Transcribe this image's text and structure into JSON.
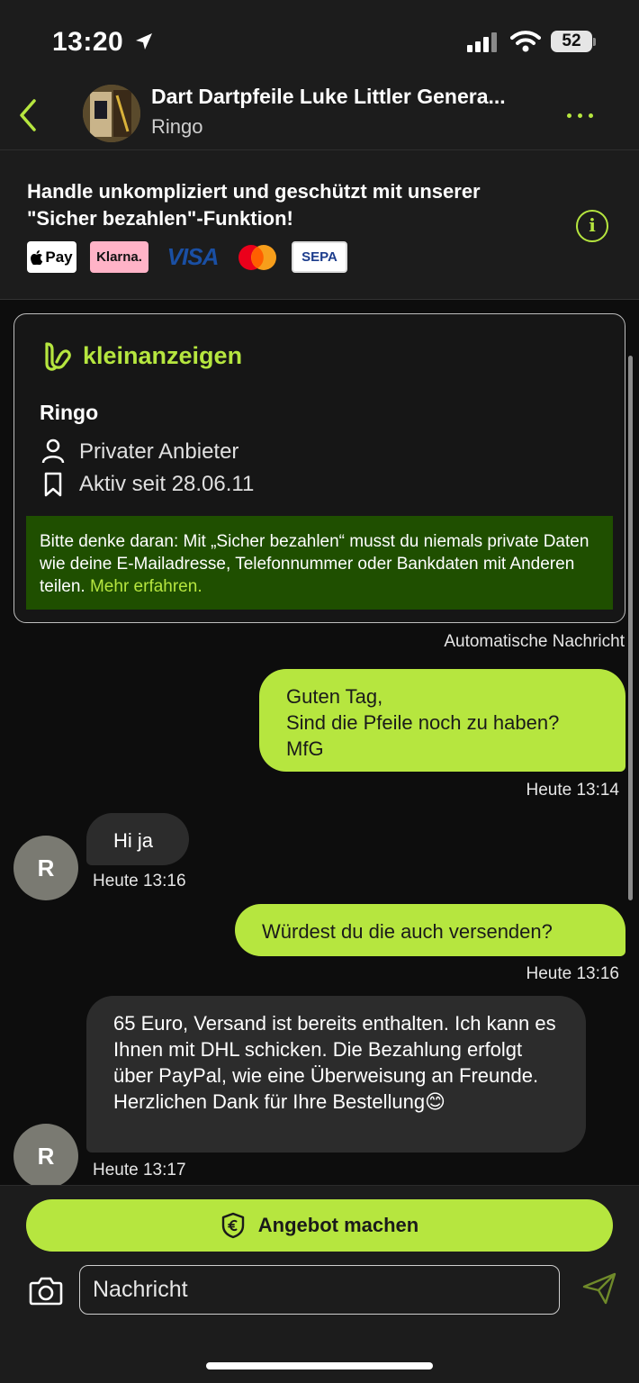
{
  "status": {
    "time": "13:20",
    "battery": "52"
  },
  "header": {
    "title": "Dart Dartpfeile Luke Littler Genera...",
    "subtitle": "Ringo"
  },
  "banner": {
    "text": "Handle unkompliziert und geschützt mit unserer \"Sicher bezahlen\"-Funktion!",
    "logos": [
      "Pay",
      "Klarna.",
      "VISA",
      "SEPA"
    ]
  },
  "card": {
    "brand": "kleinanzeigen",
    "name": "Ringo",
    "seller_type": "Privater Anbieter",
    "active_since": "Aktiv seit 28.06.11",
    "notice": "Bitte denke daran: Mit „Sicher bezahlen“ musst du niemals private Daten wie deine E-Mailadresse, Telefonnummer oder Bankdaten mit Anderen teilen.",
    "notice_link": "Mehr erfahren."
  },
  "auto_message_label": "Automatische Nachricht",
  "messages": [
    {
      "direction": "out",
      "lines": [
        "Guten Tag,",
        "Sind die Pfeile noch zu haben?",
        "MfG"
      ],
      "time": "Heute 13:14"
    },
    {
      "direction": "in",
      "text": "Hi ja",
      "time": "Heute 13:16",
      "avatar": "R"
    },
    {
      "direction": "out",
      "text": "Würdest du die auch versenden?",
      "time": "Heute 13:16"
    },
    {
      "direction": "in",
      "text": "65 Euro, Versand ist bereits enthalten. Ich kann es Ihnen mit DHL schicken. Die Bezahlung erfolgt über PayPal, wie eine Überweisung an Freunde. Herzlichen Dank für Ihre Bestellung😊",
      "time": "Heute 13:17",
      "avatar": "R"
    }
  ],
  "bottom": {
    "offer_button": "Angebot machen",
    "input_placeholder": "Nachricht"
  },
  "colors": {
    "accent": "#b6e63f",
    "notice_bg": "#1f4f00",
    "background": "#0d0d0d"
  }
}
